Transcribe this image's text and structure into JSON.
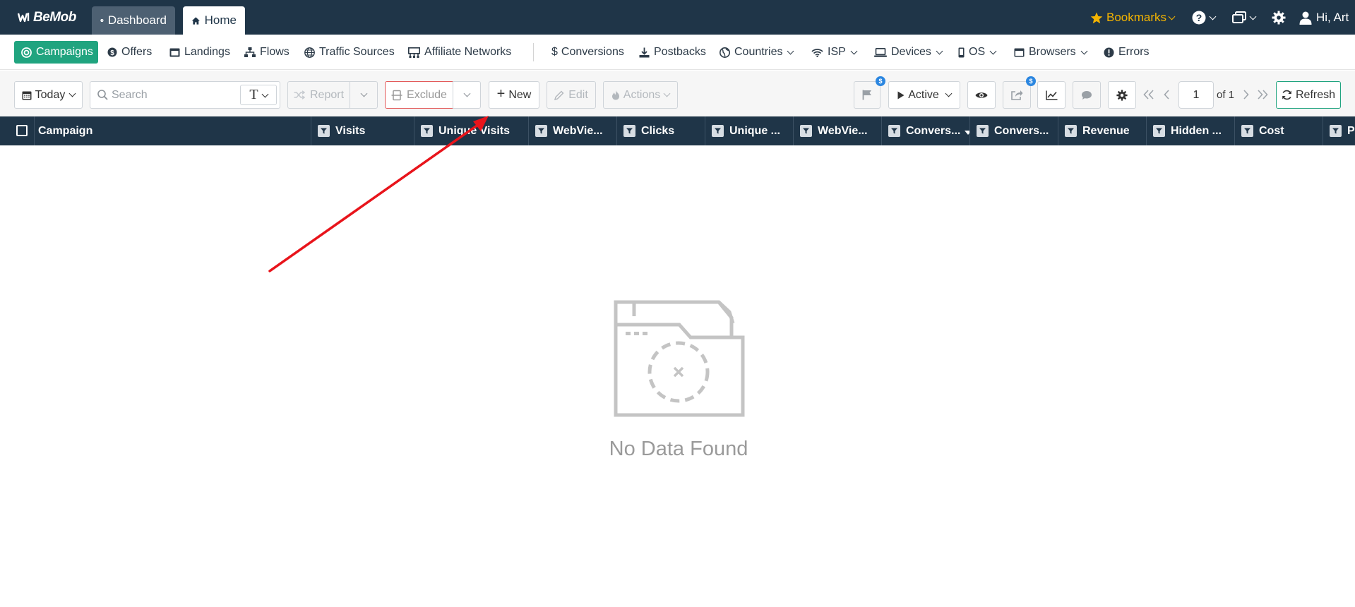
{
  "topbar": {
    "logo": "BeMob",
    "tabs": [
      {
        "label": "Dashboard",
        "icon": "gauge-icon"
      },
      {
        "label": "Home",
        "icon": "home-icon"
      }
    ],
    "bookmarks": "Bookmarks",
    "user": "Hi, Art"
  },
  "nav": {
    "items": [
      {
        "label": "Campaigns",
        "icon": "target-icon",
        "active": true
      },
      {
        "label": "Offers",
        "icon": "dollar-circle-icon"
      },
      {
        "label": "Landings",
        "icon": "page-icon"
      },
      {
        "label": "Flows",
        "icon": "sitemap-icon"
      },
      {
        "label": "Traffic Sources",
        "icon": "globe-icon"
      },
      {
        "label": "Affiliate Networks",
        "icon": "network-icon"
      },
      {
        "label": "Conversions",
        "icon": "dollar-icon"
      },
      {
        "label": "Postbacks",
        "icon": "download-icon"
      },
      {
        "label": "Countries",
        "icon": "globe-icon",
        "dropdown": true
      },
      {
        "label": "ISP",
        "icon": "wifi-icon",
        "dropdown": true
      },
      {
        "label": "Devices",
        "icon": "laptop-icon",
        "dropdown": true
      },
      {
        "label": "OS",
        "icon": "mobile-icon",
        "dropdown": true
      },
      {
        "label": "Browsers",
        "icon": "browser-icon",
        "dropdown": true
      },
      {
        "label": "Errors",
        "icon": "alert-icon"
      }
    ]
  },
  "toolbar": {
    "date": "Today",
    "search_placeholder": "Search",
    "type_label": "T",
    "report": "Report",
    "exclude": "Exclude",
    "new": "New",
    "edit": "Edit",
    "actions": "Actions",
    "badge": "$",
    "status": "Active",
    "page_value": "1",
    "page_of": "of 1",
    "refresh": "Refresh"
  },
  "table": {
    "columns": [
      "Campaign",
      "Visits",
      "Unique Visits",
      "WebVie...",
      "Clicks",
      "Unique ...",
      "WebVie...",
      "Convers...",
      "Convers...",
      "Revenue",
      "Hidden ...",
      "Cost",
      "Pr"
    ]
  },
  "empty_state": {
    "message": "No Data Found"
  },
  "colors": {
    "header_bg": "#1f3548",
    "accent": "#20a47f",
    "bookmarks": "#f4b400",
    "annotation_arrow": "#e8141b"
  }
}
